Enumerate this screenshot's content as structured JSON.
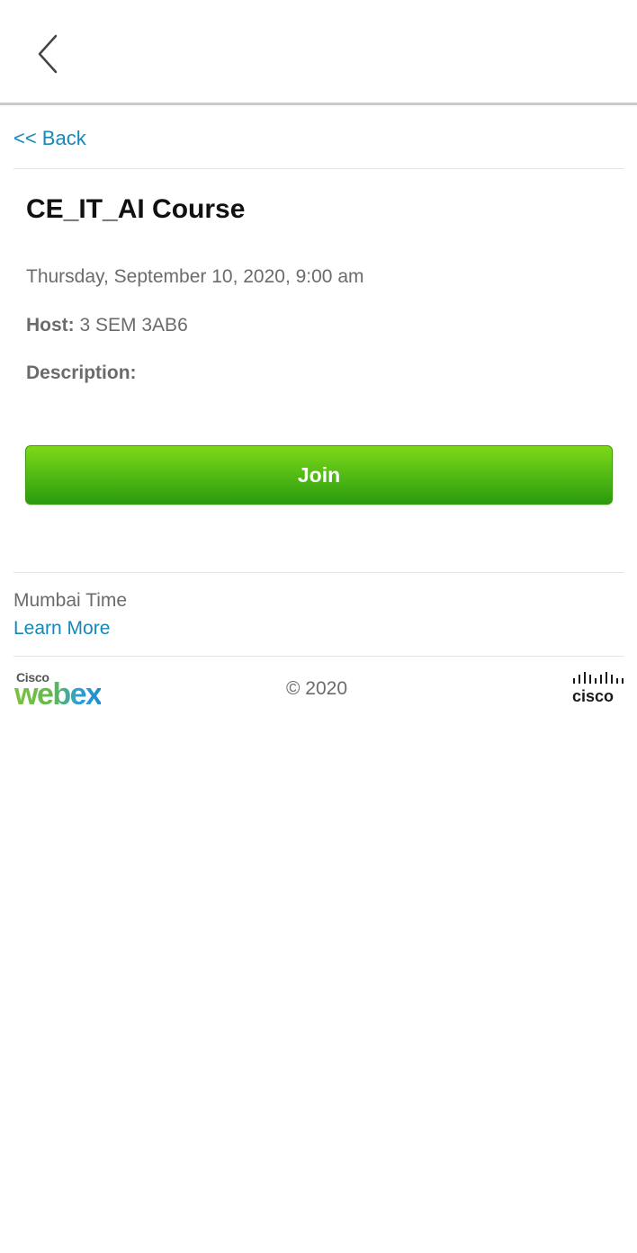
{
  "nav": {
    "back_link_label": "<< Back"
  },
  "meeting": {
    "title": "CE_IT_AI Course",
    "datetime": "Thursday, September 10, 2020, 9:00 am",
    "host_label": "Host:",
    "host_value": "3 SEM 3AB6",
    "description_label": "Description:",
    "description_value": ""
  },
  "actions": {
    "join_label": "Join"
  },
  "timezone": {
    "label": "Mumbai Time",
    "learn_more": "Learn More"
  },
  "footer": {
    "webex_brand_small": "Cisco",
    "webex_brand_word": "webex",
    "copyright": "© 2020",
    "cisco_brand": "cisco"
  },
  "colors": {
    "link": "#1488b8",
    "join_button_top": "#7ed817",
    "join_button_bottom": "#2a9a0e",
    "header_border": "#c9c9c9"
  },
  "icons": {
    "top_back": "chevron-left-icon",
    "webex_logo": "webex-logo",
    "cisco_logo": "cisco-logo"
  }
}
